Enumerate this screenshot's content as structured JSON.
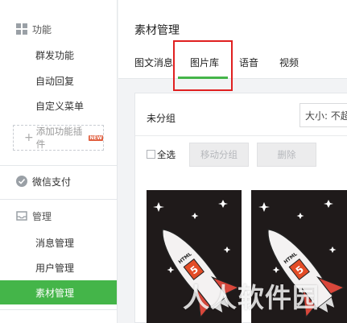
{
  "sidebar": {
    "section_function": "功能",
    "items_function": [
      "群发功能",
      "自动回复",
      "自定义菜单"
    ],
    "add_plugin": "添加功能插件",
    "new_badge": "NEW",
    "section_pay": "微信支付",
    "section_manage": "管理",
    "items_manage": [
      "消息管理",
      "用户管理",
      "素材管理"
    ],
    "active_item": "素材管理"
  },
  "main": {
    "title": "素材管理",
    "tabs": [
      "图文消息",
      "图片库",
      "语音",
      "视频"
    ],
    "active_tab": "图片库",
    "group_label": "未分组",
    "size_text": "大小: 不超",
    "select_all": "全选",
    "move_group": "移动分组",
    "delete": "删除"
  },
  "watermark": "人人软件园",
  "colors": {
    "accent": "#44b549",
    "highlight": "#e02020",
    "badge": "#e15f3f"
  }
}
